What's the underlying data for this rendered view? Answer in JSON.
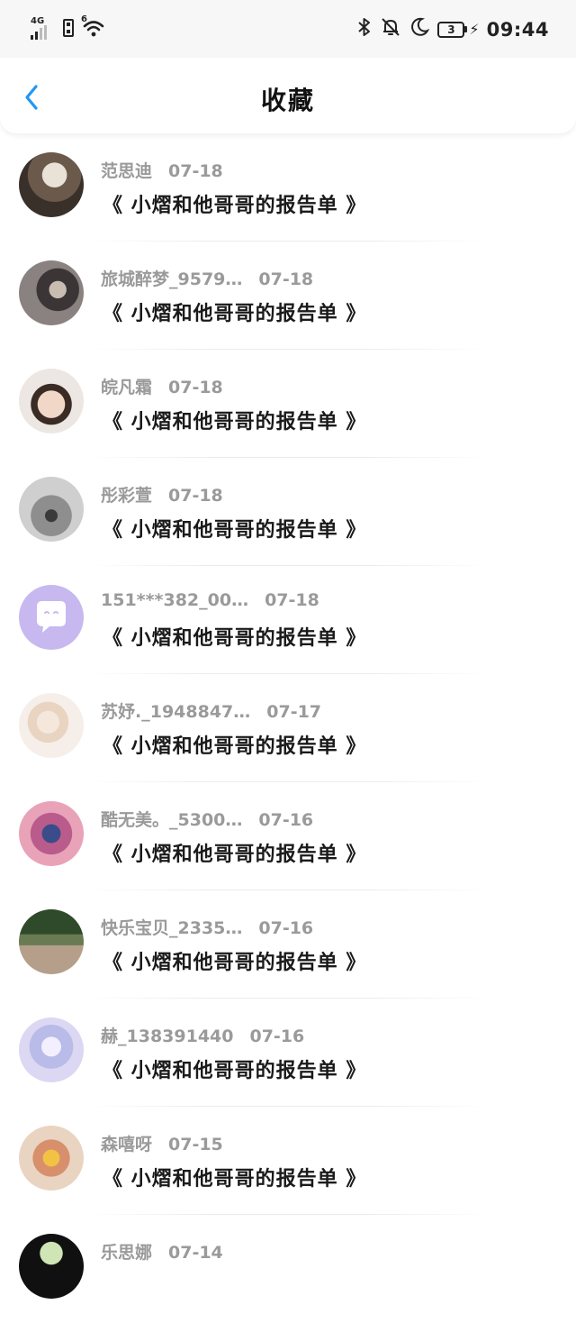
{
  "status_bar": {
    "network_label": "4G",
    "wifi_label": "6",
    "battery_level": "3",
    "time": "09:44"
  },
  "header": {
    "back_icon": "chevron-left-icon",
    "title": "收藏",
    "accent_color": "#2196F3"
  },
  "items": [
    {
      "name": "范思迪",
      "date": "07-18",
      "title": "《 小熠和他哥哥的报告单 》"
    },
    {
      "name": "旅城醉梦_9579…",
      "date": "07-18",
      "title": "《 小熠和他哥哥的报告单 》"
    },
    {
      "name": "皖凡霜",
      "date": "07-18",
      "title": "《 小熠和他哥哥的报告单 》"
    },
    {
      "name": "彤彩萱",
      "date": "07-18",
      "title": "《 小熠和他哥哥的报告单 》"
    },
    {
      "name": "151***382_00…",
      "date": "07-18",
      "title": "《 小熠和他哥哥的报告单 》"
    },
    {
      "name": "苏妤._1948847…",
      "date": "07-17",
      "title": "《 小熠和他哥哥的报告单 》"
    },
    {
      "name": "酷无美。_5300…",
      "date": "07-16",
      "title": "《 小熠和他哥哥的报告单 》"
    },
    {
      "name": "快乐宝贝_2335…",
      "date": "07-16",
      "title": "《 小熠和他哥哥的报告单 》"
    },
    {
      "name": "赫_138391440",
      "date": "07-16",
      "title": "《 小熠和他哥哥的报告单 》"
    },
    {
      "name": "森嘻呀",
      "date": "07-15",
      "title": "《 小熠和他哥哥的报告单 》"
    },
    {
      "name": "乐思娜",
      "date": "07-14",
      "title": ""
    }
  ]
}
